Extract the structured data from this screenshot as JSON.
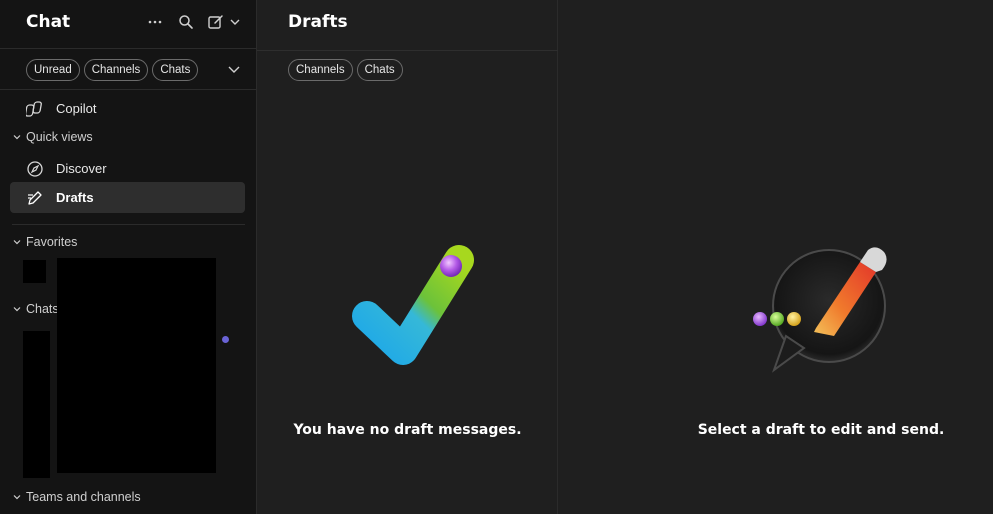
{
  "sidebar": {
    "title": "Chat",
    "filters": [
      "Unread",
      "Channels",
      "Chats"
    ],
    "items": [
      {
        "label": "Copilot",
        "icon": "copilot-icon"
      },
      {
        "label": "Discover",
        "icon": "discover-icon"
      },
      {
        "label": "Drafts",
        "icon": "drafts-icon",
        "active": true
      }
    ],
    "sections": {
      "quick_views": "Quick views",
      "favorites": "Favorites",
      "chats": "Chats",
      "teams": "Teams and channels"
    }
  },
  "middle": {
    "title": "Drafts",
    "filters": [
      "Channels",
      "Chats"
    ],
    "empty_message": "You have no draft messages."
  },
  "right": {
    "message": "Select a draft to edit and send."
  },
  "colors": {
    "sidebar_bg": "#141414",
    "pane_bg": "#1f1f1f",
    "active_item": "#2e2e2e",
    "presence": "#6a63d6"
  }
}
